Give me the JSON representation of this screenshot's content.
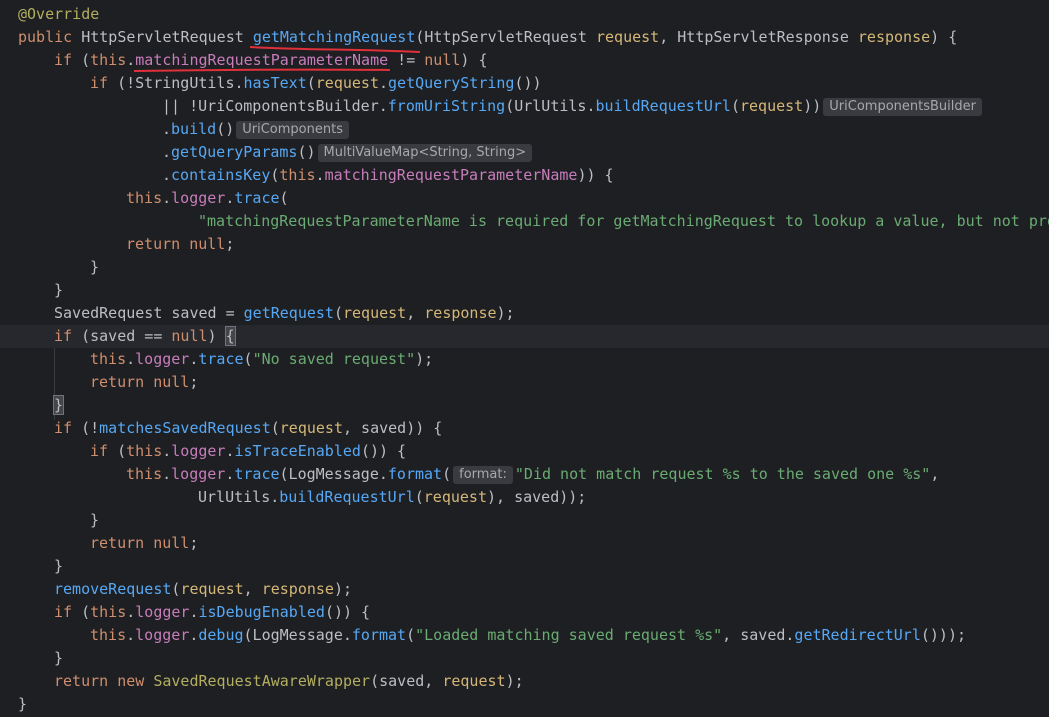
{
  "editor": {
    "language": "Java",
    "colors": {
      "background": "#1e1f22",
      "keyword": "#cf8e6d",
      "annotation": "#b3ae60",
      "method": "#56a8f5",
      "field": "#c77dbb",
      "parameter": "#d5b778",
      "string": "#6aab73",
      "default": "#bcbec4",
      "inlay_hint_bg": "#393b40",
      "red_annotation_mark": "#e0303a"
    },
    "hints": {
      "uricomponentsbuilder": "UriComponentsBuilder",
      "uricomponents": "UriComponents",
      "multivaluemap": "MultiValueMap<String, String>",
      "format_param": "format:"
    },
    "lines": [
      "@Override",
      "public HttpServletRequest getMatchingRequest(HttpServletRequest request, HttpServletResponse response) {",
      "    if (this.matchingRequestParameterName != null) {",
      "        if (!StringUtils.hasText(request.getQueryString())",
      "                || !UriComponentsBuilder.fromUriString(UrlUtils.buildRequestUrl(request))",
      "                .build()",
      "                .getQueryParams()",
      "                .containsKey(this.matchingRequestParameterName)) {",
      "            this.logger.trace(",
      "                    \"matchingRequestParameterName is required for getMatchingRequest to lookup a value, but not pro",
      "            return null;",
      "        }",
      "    }",
      "    SavedRequest saved = getRequest(request, response);",
      "    if (saved == null) {",
      "        this.logger.trace(\"No saved request\");",
      "        return null;",
      "    }",
      "    if (!matchesSavedRequest(request, saved)) {",
      "        if (this.logger.isTraceEnabled()) {",
      "            this.logger.trace(LogMessage.format(\"Did not match request %s to the saved one %s\",",
      "                    UrlUtils.buildRequestUrl(request), saved));",
      "        }",
      "        return null;",
      "    }",
      "    removeRequest(request, response);",
      "    if (this.logger.isDebugEnabled()) {",
      "        this.logger.debug(LogMessage.format(\"Loaded matching saved request %s\", saved.getRedirectUrl()));",
      "    }",
      "    return new SavedRequestAwareWrapper(saved, request);",
      "}"
    ]
  }
}
